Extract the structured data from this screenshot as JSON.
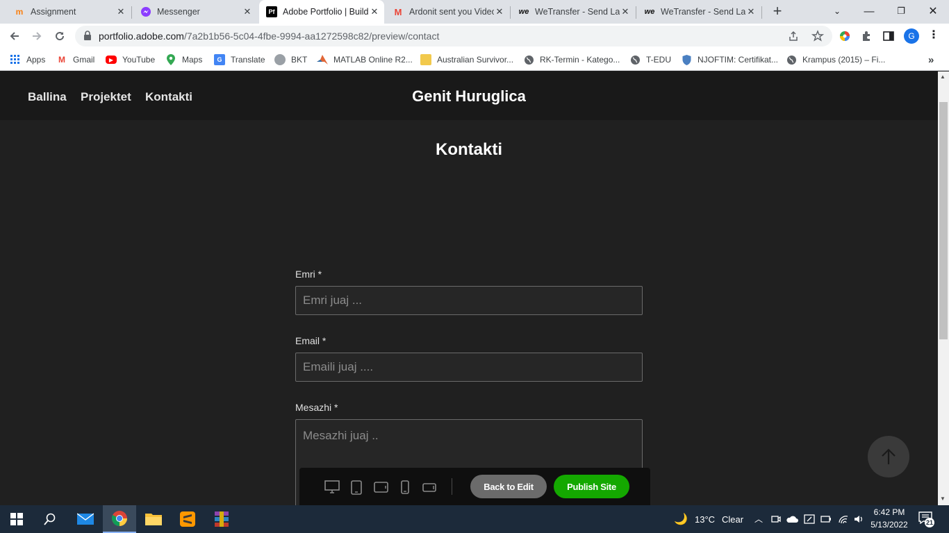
{
  "browser": {
    "tabs": [
      {
        "title": "Assignment",
        "active": false,
        "favicon": "moodle-icon"
      },
      {
        "title": "Messenger",
        "active": false,
        "favicon": "messenger-icon"
      },
      {
        "title": "Adobe Portfolio | Build",
        "active": true,
        "favicon": "portfolio-icon",
        "favicon_text": "Pf"
      },
      {
        "title": "Ardonit sent you Video",
        "active": false,
        "favicon": "gmail-icon"
      },
      {
        "title": "WeTransfer - Send Larg",
        "active": false,
        "favicon": "wetransfer-icon",
        "favicon_text": "we"
      },
      {
        "title": "WeTransfer - Send Larg",
        "active": false,
        "favicon": "wetransfer-icon",
        "favicon_text": "we"
      }
    ],
    "url_domain": "portfolio.adobe.com",
    "url_path": "/7a2b1b56-5c04-4fbe-9994-aa1272598c82/preview/contact",
    "profile_initial": "G",
    "bookmarks": [
      {
        "label": "Apps",
        "icon": "apps-grid-icon"
      },
      {
        "label": "Gmail",
        "icon": "gmail-icon"
      },
      {
        "label": "YouTube",
        "icon": "youtube-icon"
      },
      {
        "label": "Maps",
        "icon": "maps-icon"
      },
      {
        "label": "Translate",
        "icon": "translate-icon"
      },
      {
        "label": "BKT",
        "icon": "bkt-icon"
      },
      {
        "label": "MATLAB Online R2...",
        "icon": "matlab-icon"
      },
      {
        "label": "Australian Survivor...",
        "icon": "folder-icon"
      },
      {
        "label": "RK-Termin - Katego...",
        "icon": "globe-icon"
      },
      {
        "label": "T-EDU",
        "icon": "globe-icon"
      },
      {
        "label": "NJOFTIM: Certifikat...",
        "icon": "shield-icon"
      },
      {
        "label": "Krampus (2015) – Fi...",
        "icon": "globe-icon"
      }
    ]
  },
  "site": {
    "nav": [
      "Ballina",
      "Projektet",
      "Kontakti"
    ],
    "title": "Genit Huruglica",
    "page_title": "Kontakti",
    "form": {
      "name_label": "Emri *",
      "name_placeholder": "Emri juaj ...",
      "email_label": "Email *",
      "email_placeholder": "Emaili juaj ....",
      "message_label": "Mesazhi *",
      "message_placeholder": "Mesazhi juaj .."
    }
  },
  "preview_bar": {
    "back_label": "Back to Edit",
    "publish_label": "Publish Site",
    "publish_color": "#14a800"
  },
  "taskbar": {
    "weather_temp": "13°C",
    "weather_text": "Clear",
    "time": "6:42 PM",
    "date": "5/13/2022",
    "notification_count": "21"
  }
}
